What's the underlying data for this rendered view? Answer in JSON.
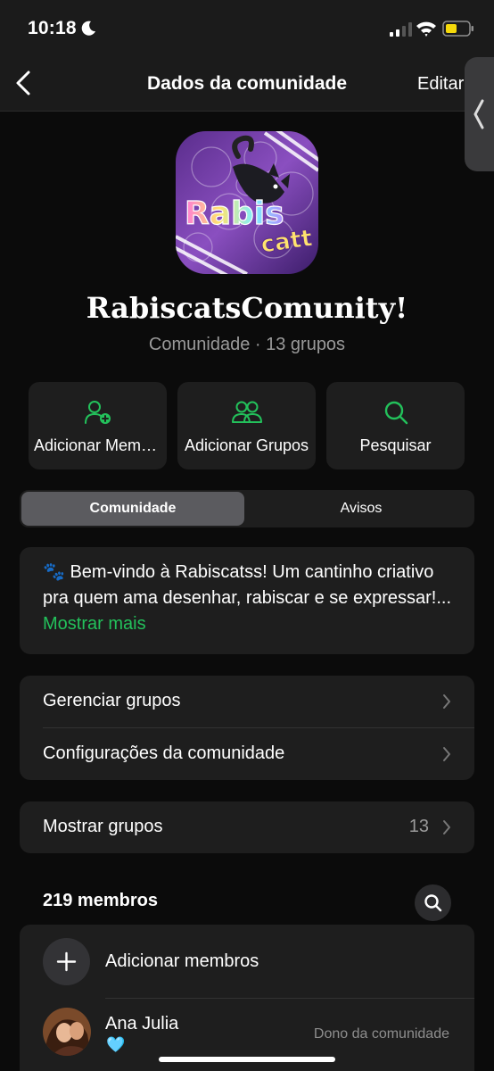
{
  "status_bar": {
    "time": "10:18",
    "battery_color": "#f5d90a"
  },
  "header": {
    "title": "Dados da comunidade",
    "edit_label": "Editar"
  },
  "community": {
    "avatar_lines": [
      "Rabis",
      "catt"
    ],
    "name": "RabiscatsComunity!",
    "subtitle": "Comunidade · 13 grupos"
  },
  "actions": [
    {
      "label": "Adicionar Membros",
      "icon": "add-person-icon"
    },
    {
      "label": "Adicionar Grupos",
      "icon": "people-icon"
    },
    {
      "label": "Pesquisar",
      "icon": "search-icon"
    }
  ],
  "tabs": [
    {
      "label": "Comunidade",
      "selected": true
    },
    {
      "label": "Avisos",
      "selected": false
    }
  ],
  "description": {
    "emoji": "🐾",
    "text": " Bem-vindo à Rabiscatss! Um cantinho criativo pra quem ama desenhar, rabiscar e se expressar!... ",
    "more_label": "Mostrar mais"
  },
  "settings": [
    {
      "label": "Gerenciar grupos"
    },
    {
      "label": "Configurações da comunidade"
    }
  ],
  "groups_row": {
    "label": "Mostrar grupos",
    "count": "13"
  },
  "members": {
    "title": "219 membros",
    "add_label": "Adicionar membros",
    "list": [
      {
        "name": "Ana Julia",
        "status_emoji": "🩵",
        "role": "Dono da comunidade"
      }
    ]
  },
  "colors": {
    "accent": "#23c15b",
    "background": "#0b0b0b",
    "card": "#1e1e1e"
  }
}
